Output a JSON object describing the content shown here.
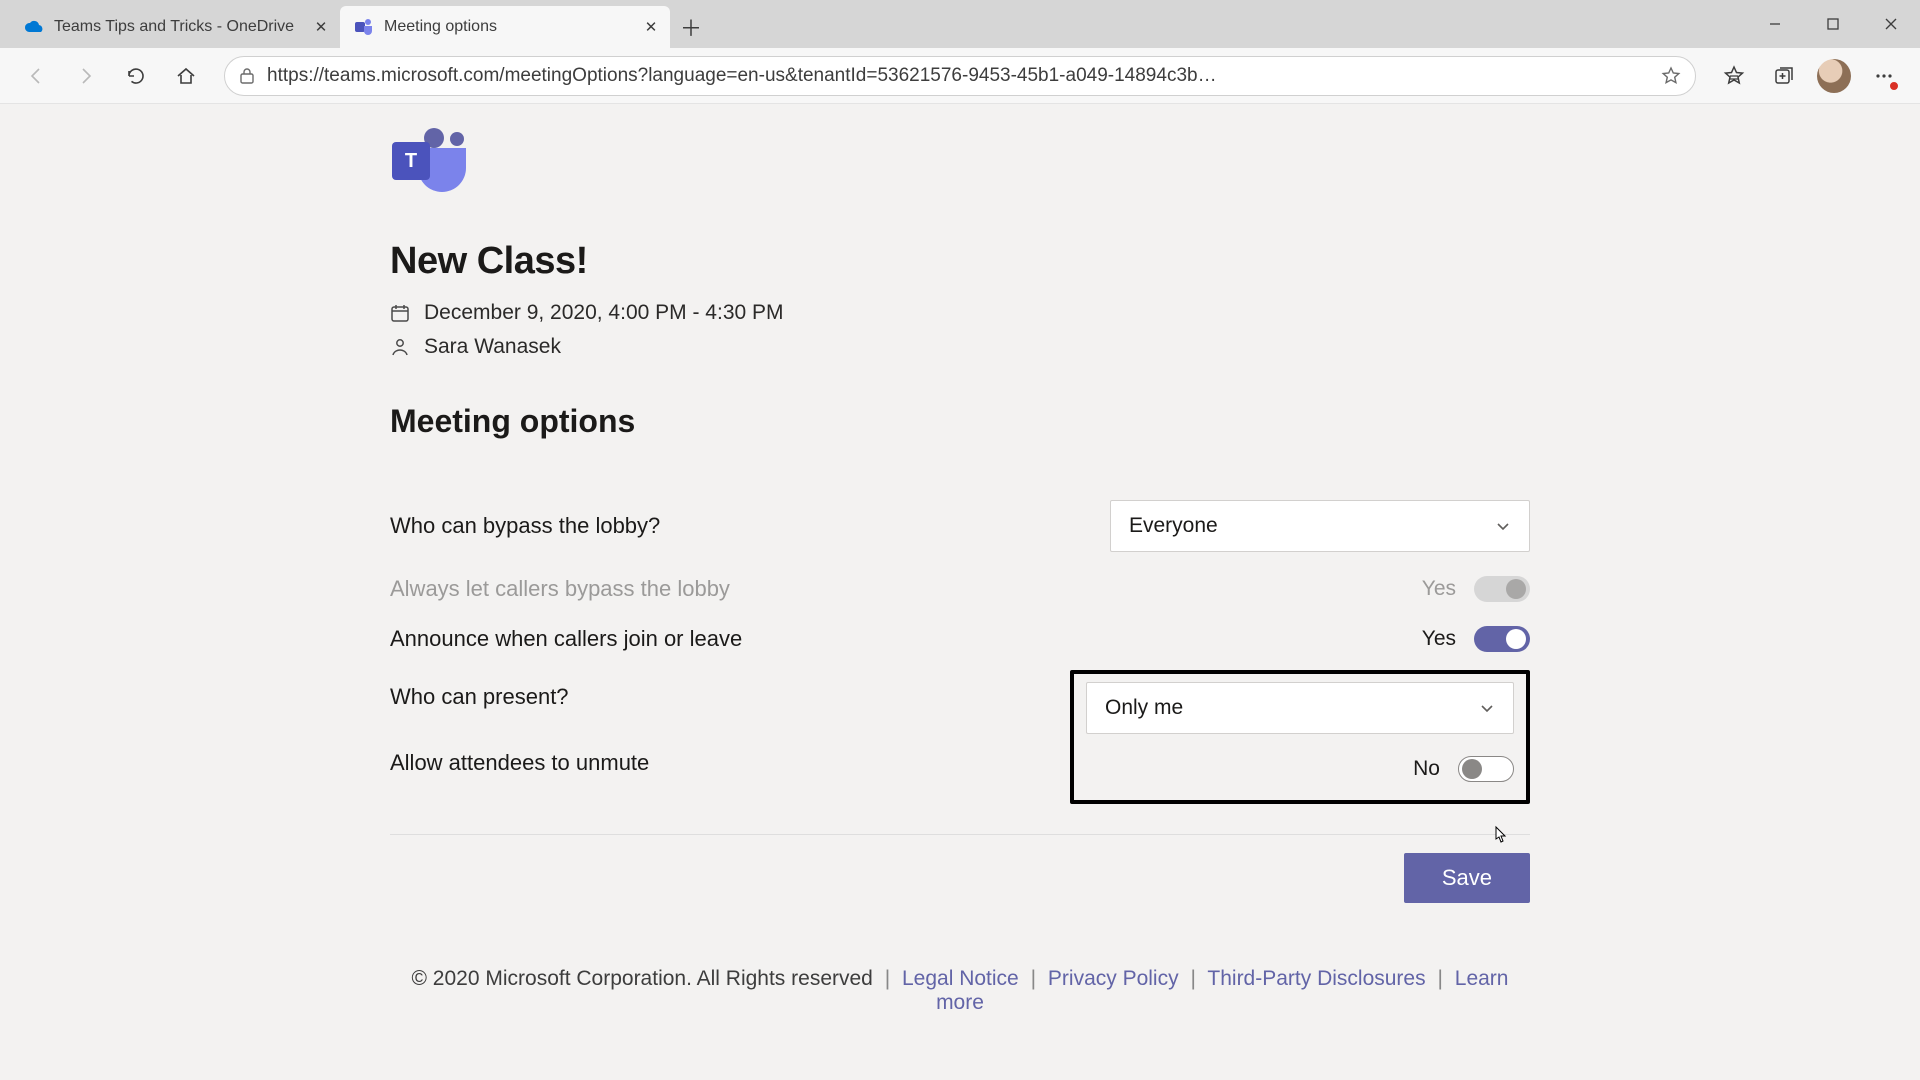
{
  "browser": {
    "tabs": [
      {
        "title": "Teams Tips and Tricks - OneDrive",
        "active": false
      },
      {
        "title": "Meeting options",
        "active": true
      }
    ],
    "url": "https://teams.microsoft.com/meetingOptions?language=en-us&tenantId=53621576-9453-45b1-a049-14894c3b…"
  },
  "logo_letter": "T",
  "meeting": {
    "title": "New Class!",
    "datetime": "December 9, 2020, 4:00 PM - 4:30 PM",
    "organizer": "Sara Wanasek"
  },
  "section_heading": "Meeting options",
  "options": {
    "bypass_lobby": {
      "label": "Who can bypass the lobby?",
      "value": "Everyone"
    },
    "callers_bypass": {
      "label": "Always let callers bypass the lobby",
      "value": "Yes",
      "state": "on",
      "disabled": true
    },
    "announce": {
      "label": "Announce when callers join or leave",
      "value": "Yes",
      "state": "on"
    },
    "present": {
      "label": "Who can present?",
      "value": "Only me"
    },
    "unmute": {
      "label": "Allow attendees to unmute",
      "value": "No",
      "state": "off"
    }
  },
  "save_label": "Save",
  "footer": {
    "copyright": "© 2020 Microsoft Corporation. All Rights reserved",
    "links": [
      "Legal Notice",
      "Privacy Policy",
      "Third-Party Disclosures",
      "Learn more"
    ]
  }
}
